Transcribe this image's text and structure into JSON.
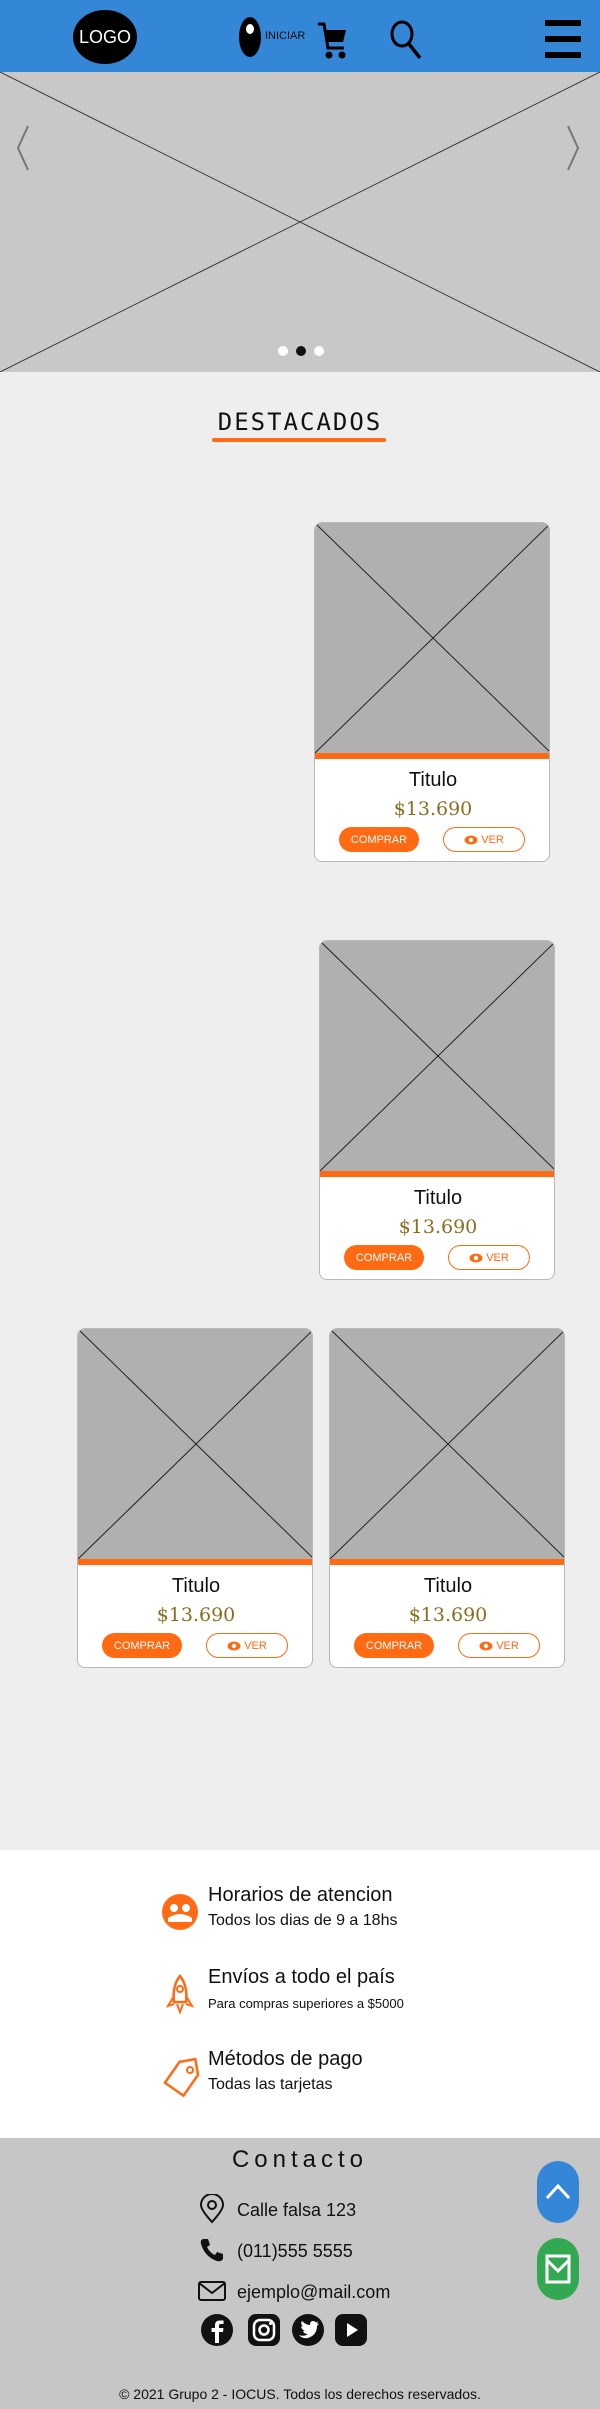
{
  "header": {
    "logo_text": "LOGO",
    "login_label": "INICIAR",
    "icons": [
      "user-icon",
      "cart-icon",
      "search-icon",
      "menu-icon"
    ],
    "background_color": "#3486d7"
  },
  "carousel": {
    "slide_count": 3,
    "active_slide": 2
  },
  "featured": {
    "title": "DESTACADOS",
    "products": [
      {
        "title": "Titulo",
        "price": "$13.690",
        "buy_label": "COMPRAR",
        "view_label": "VER"
      },
      {
        "title": "Titulo",
        "price": "$13.690",
        "buy_label": "COMPRAR",
        "view_label": "VER"
      },
      {
        "title": "Titulo",
        "price": "$13.690",
        "buy_label": "COMPRAR",
        "view_label": "VER"
      },
      {
        "title": "Titulo",
        "price": "$13.690",
        "buy_label": "COMPRAR",
        "view_label": "VER"
      }
    ]
  },
  "info": {
    "items": [
      {
        "icon": "headset-icon",
        "title": "Horarios de atencion",
        "detail": "Todos los dias de 9 a 18hs"
      },
      {
        "icon": "rocket-icon",
        "title": "Envíos a todo el país",
        "detail": "Para compras superiores a $5000"
      },
      {
        "icon": "tag-icon",
        "title": "Métodos de pago",
        "detail": "Todas las tarjetas"
      }
    ]
  },
  "footer": {
    "contact_title": "Contacto",
    "address": "Calle falsa 123",
    "phone": "(011)555 5555",
    "email": "ejemplo@mail.com",
    "social_icons": [
      "facebook-icon",
      "instagram-icon",
      "twitter-icon",
      "youtube-icon"
    ],
    "copyright": "© 2021 Grupo 2 - IOCUS. Todos los derechos reservados."
  },
  "colors": {
    "accent": "#ff6a13",
    "primary": "#3486d7",
    "success": "#32a852"
  }
}
